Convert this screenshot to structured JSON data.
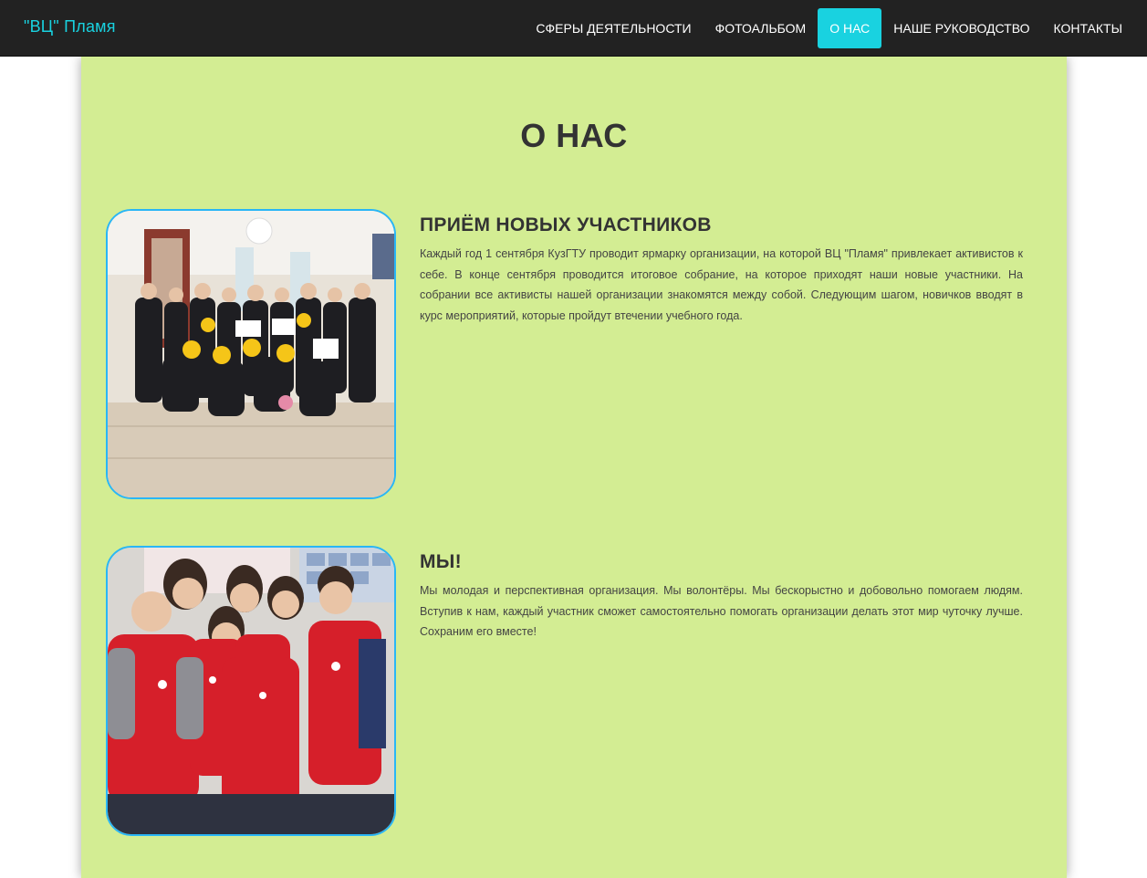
{
  "navbar": {
    "brand": "\"ВЦ\" Пламя",
    "items": [
      {
        "label": "СФЕРЫ ДЕЯТЕЛЬНОСТИ",
        "active": false
      },
      {
        "label": "ФОТОАЛЬБОМ",
        "active": false
      },
      {
        "label": "О НАС",
        "active": true
      },
      {
        "label": "НАШЕ РУКОВОДСТВО",
        "active": false
      },
      {
        "label": "КОНТАКТЫ",
        "active": false
      }
    ]
  },
  "colors": {
    "navbar_bg": "#222222",
    "accent": "#19d2e0",
    "content_bg": "#d3ed93",
    "photo_border": "#29b6f6",
    "text": "#333333"
  },
  "main": {
    "title": "О НАС",
    "sections": [
      {
        "heading": "ПРИЁМ НОВЫХ УЧАСТНИКОВ",
        "text": "Каждый год 1 сентября КузГТУ проводит ярмарку организации, на которой ВЦ \"Пламя\" привлекает активистов к себе. В конце сентября проводится итоговое собрание, на которое приходят наши новые участники. На собрании все активисты нашей организации знакомятся между собой. Следующим шагом, новичков вводят в курс мероприятий, которые пройдут втечении учебного года.",
        "image": "group-photo-new-members"
      },
      {
        "heading": "МЫ!",
        "text": "Мы молодая и перспективная организация. Мы волонтёры. Мы бескорыстно и добовольно помогаем людям. Вступив к нам, каждый участник сможет самостоятельно помогать организации делать этот мир чуточку лучше. Сохраним его вместе!",
        "image": "volunteers-in-red-vests-photo"
      }
    ]
  }
}
